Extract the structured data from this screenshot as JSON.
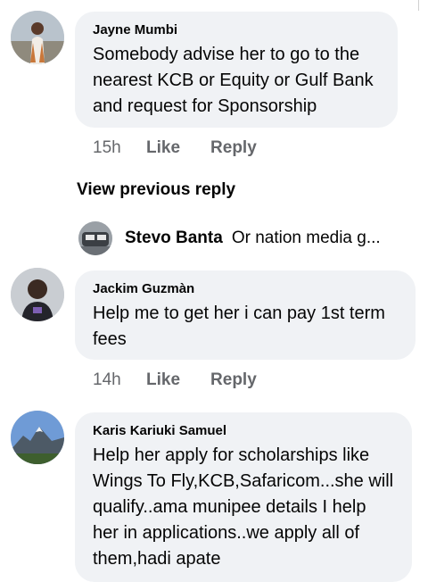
{
  "comments": [
    {
      "author": "Jayne Mumbi",
      "text": "Somebody advise her to go to the nearest KCB or Equity or Gulf Bank and request for Sponsorship",
      "time": "15h",
      "like_label": "Like",
      "reply_label": "Reply"
    },
    {
      "author": "Jackim Guzmàn",
      "text": "Help me to get her i can pay 1st term fees",
      "time": "14h",
      "like_label": "Like",
      "reply_label": "Reply"
    },
    {
      "author": "Karis Kariuki Samuel",
      "text": "Help her apply for scholarships like Wings To Fly,KCB,Safaricom...she will qualify..ama munipee details I help her in applications..we apply all of them,hadi apate"
    }
  ],
  "view_previous_reply": "View previous reply",
  "reply_preview": {
    "author": "Stevo Banta",
    "text": "Or nation media g..."
  }
}
